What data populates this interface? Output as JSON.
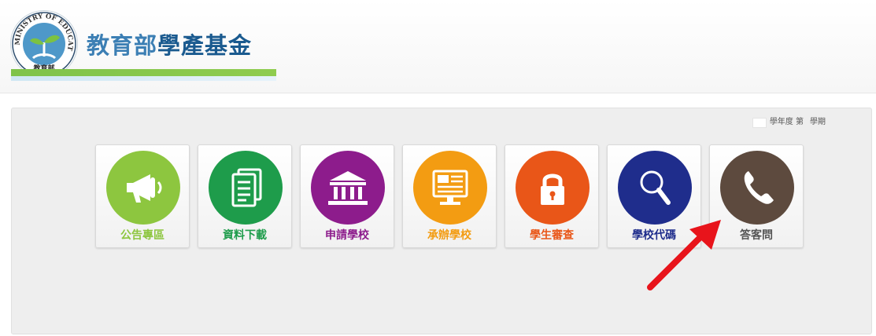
{
  "header": {
    "seal": {
      "ring_text": "MINISTRY OF EDUCATION",
      "center_text": "教育部"
    },
    "title_part1": "教育部",
    "title_part2": "學產基金"
  },
  "term": {
    "text1": "學年度 第",
    "text2": "學期"
  },
  "tiles": [
    {
      "label": "公告專區",
      "color": "#8dc63f",
      "label_color": "#8dc63f",
      "icon": "megaphone-icon"
    },
    {
      "label": "資料下載",
      "color": "#1e9c4b",
      "label_color": "#1e9c4b",
      "icon": "document-icon"
    },
    {
      "label": "申請學校",
      "color": "#8d1c8c",
      "label_color": "#8d1c8c",
      "icon": "building-icon"
    },
    {
      "label": "承辦學校",
      "color": "#f39c12",
      "label_color": "#f39c12",
      "icon": "monitor-icon"
    },
    {
      "label": "學生審查",
      "color": "#e95618",
      "label_color": "#e95618",
      "icon": "lock-icon"
    },
    {
      "label": "學校代碼",
      "color": "#1f2d8c",
      "label_color": "#1f2d8c",
      "icon": "search-icon"
    },
    {
      "label": "答客問",
      "color": "#5d4a3e",
      "label_color": "#555555",
      "icon": "phone-icon"
    }
  ],
  "annotation": {
    "arrow_color": "#e8141b"
  }
}
